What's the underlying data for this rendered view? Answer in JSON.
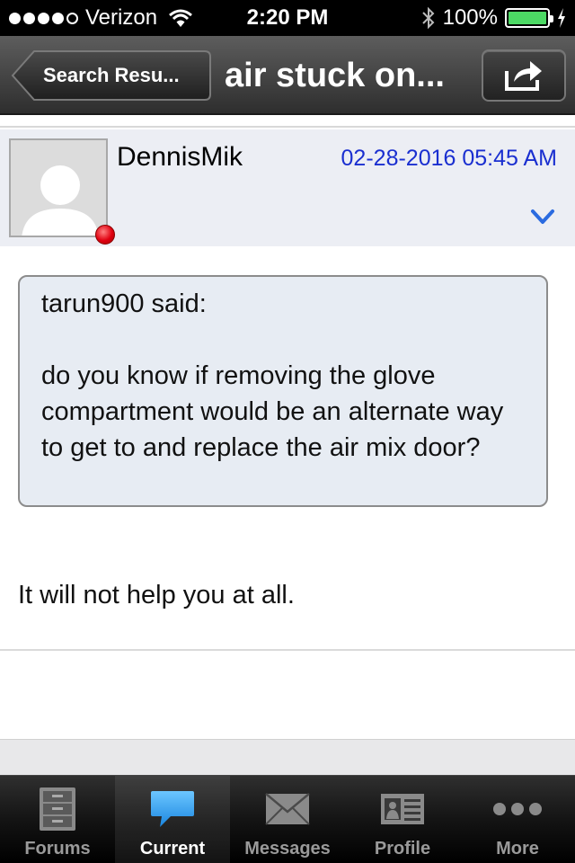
{
  "status_bar": {
    "carrier": "Verizon",
    "time": "2:20 PM",
    "battery": "100%",
    "battery_level": 1.0,
    "signal_bars_filled": 4,
    "signal_bars_total": 5
  },
  "nav_bar": {
    "back_label": "Search Resu...",
    "title": "air stuck on...",
    "share_icon": "share-icon"
  },
  "post": {
    "username": "DennisMik",
    "date": "02-28-2016 05:45 AM",
    "status_color": "#e00010",
    "quote": {
      "author": "tarun900 said:",
      "text": "do you know if removing the glove compartment would be an alternate way to get to and replace the air mix door?"
    },
    "body": "It will not help you at all."
  },
  "tab_bar": {
    "tabs": [
      {
        "label": "Forums",
        "icon": "cabinet-icon",
        "active": false
      },
      {
        "label": "Current",
        "icon": "speech-bubble-icon",
        "active": true
      },
      {
        "label": "Messages",
        "icon": "envelope-icon",
        "active": false
      },
      {
        "label": "Profile",
        "icon": "id-card-icon",
        "active": false
      },
      {
        "label": "More",
        "icon": "more-dots-icon",
        "active": false
      }
    ]
  },
  "colors": {
    "link_blue": "#1a2fd0",
    "quote_bg": "#e7ecf3",
    "header_bg": "#eceef4",
    "active_tab_icon": "#2d9cf0",
    "battery_green": "#4cd964"
  }
}
